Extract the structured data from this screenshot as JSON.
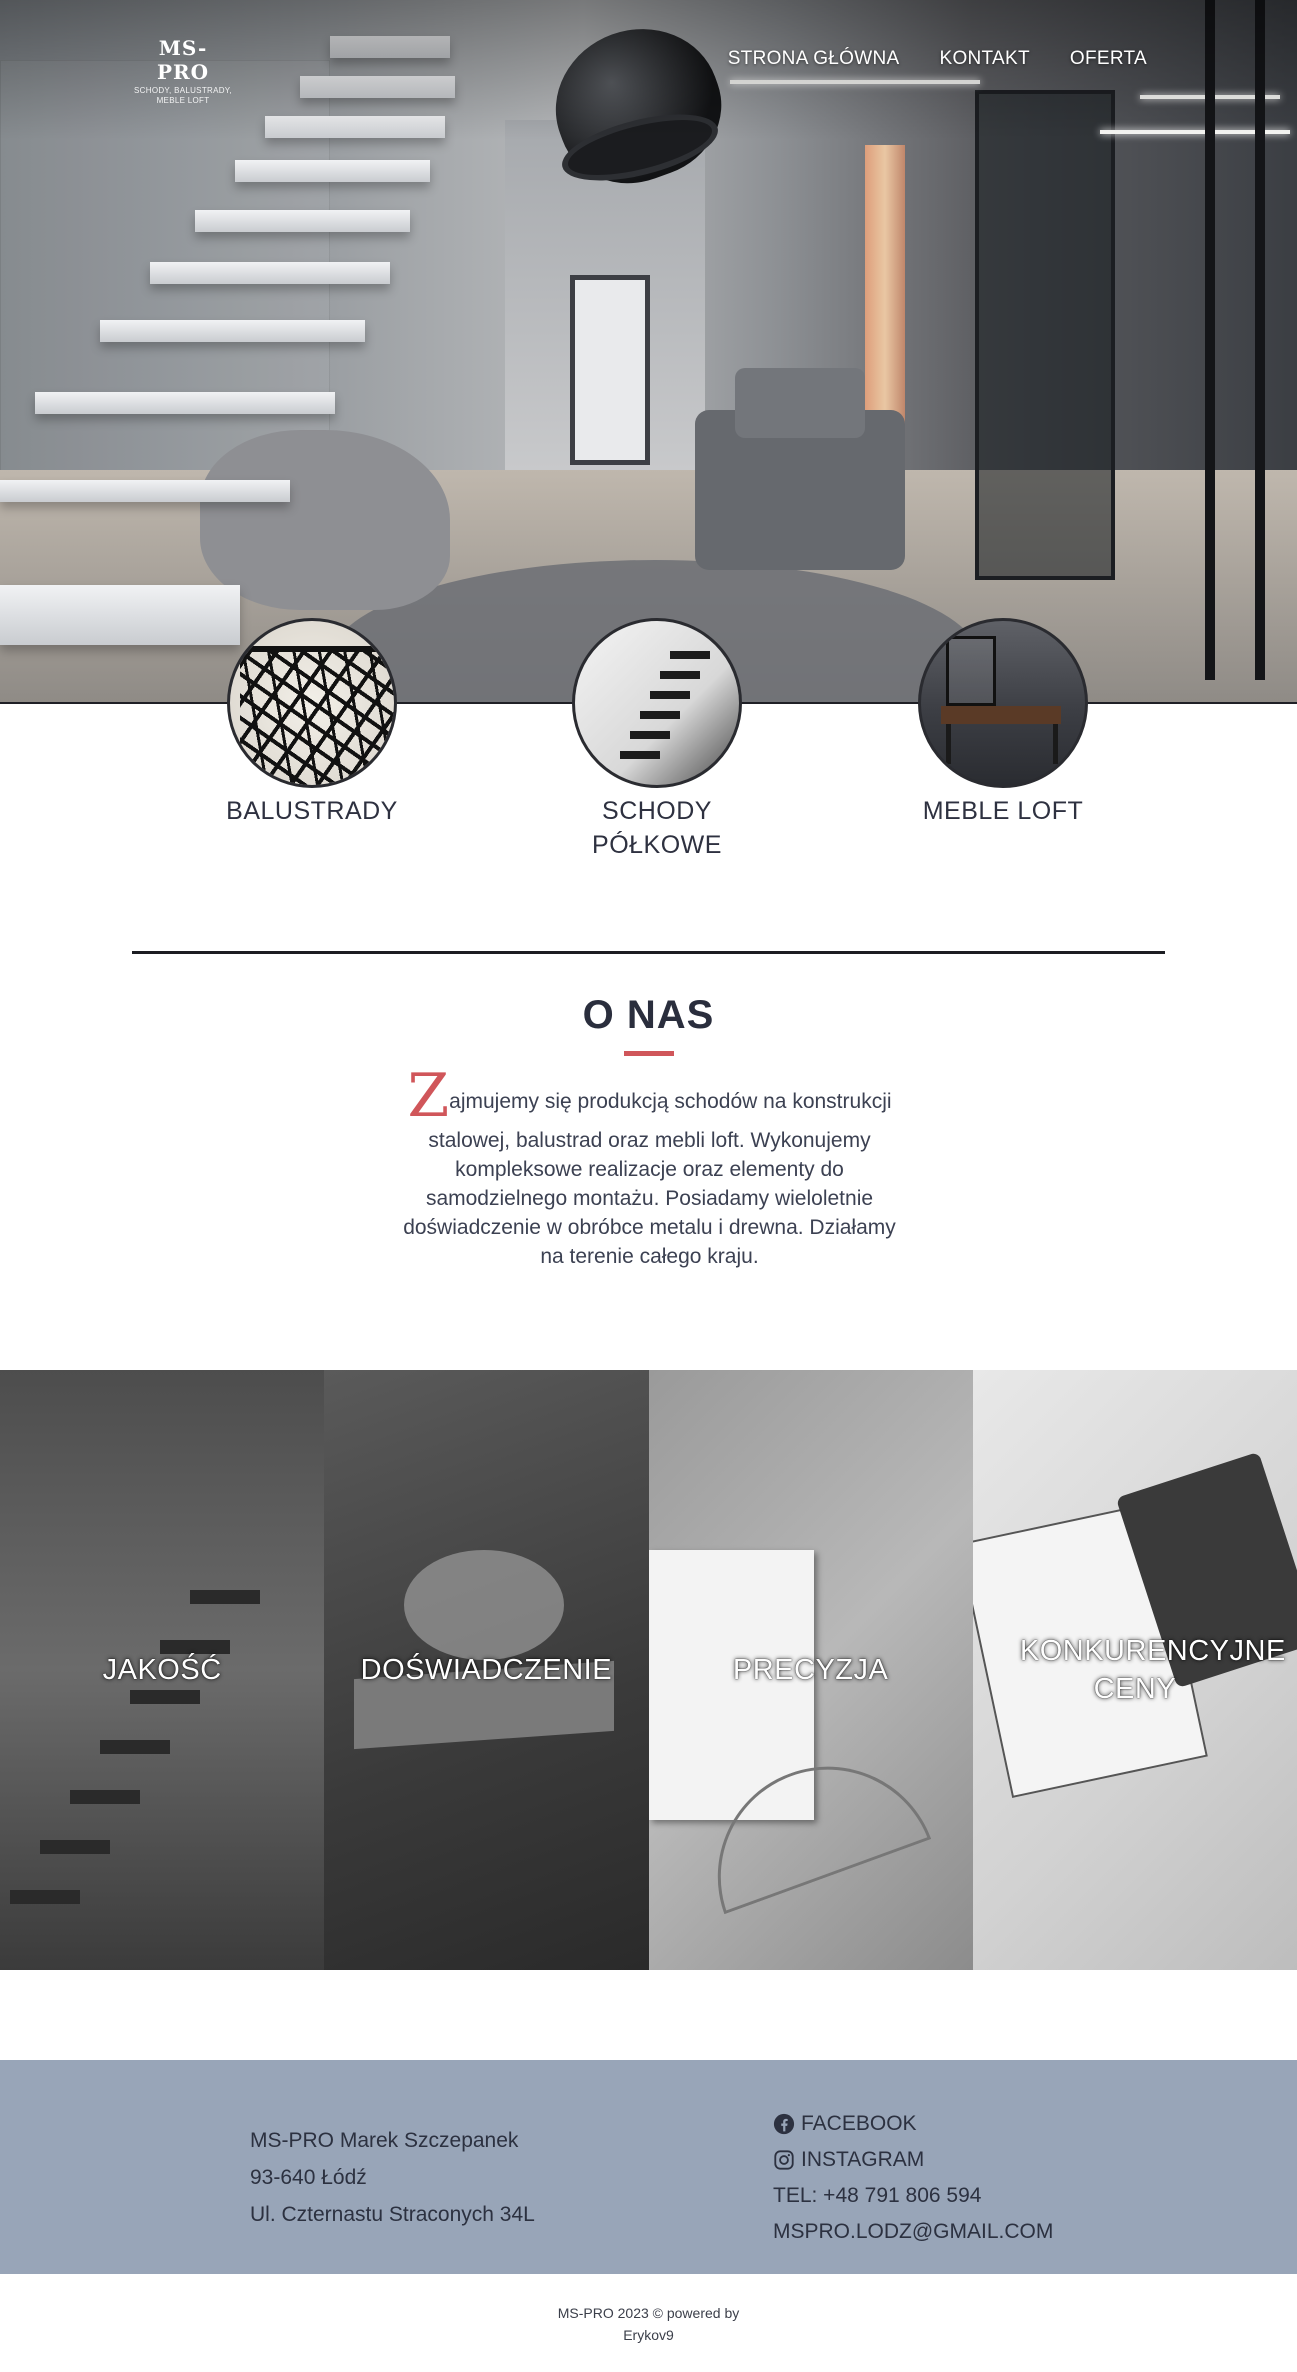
{
  "logo": {
    "title": "MS-PRO",
    "subtitle": "SCHODY, BALUSTRADY, MEBLE LOFT"
  },
  "nav": {
    "items": [
      {
        "label": "STRONA GŁÓWNA"
      },
      {
        "label": "KONTAKT"
      },
      {
        "label": "OFERTA"
      }
    ]
  },
  "categories": [
    {
      "label": "BALUSTRADY"
    },
    {
      "label": "SCHODY PÓŁKOWE"
    },
    {
      "label": "MEBLE LOFT"
    }
  ],
  "about": {
    "title": "O NAS",
    "drop_letter": "Z",
    "text": "ajmujemy się produkcją schodów na konstrukcji stalowej, balustrad oraz mebli loft. Wykonujemy kompleksowe realizacje oraz elementy do samodzielnego montażu. Posiadamy wieloletnie doświadczenie w obróbce metalu i drewna. Działamy na terenie całego kraju."
  },
  "features": [
    {
      "label": "JAKOŚĆ"
    },
    {
      "label": "DOŚWIADCZENIE"
    },
    {
      "label": "PRECYZJA"
    },
    {
      "label": "KONKURENCYJNE CENY"
    }
  ],
  "footer": {
    "address": {
      "name": "MS-PRO Marek Szczepanek",
      "city": "93-640 Łódź",
      "street": "Ul. Czternastu Straconych 34L"
    },
    "contact": {
      "facebook": "FACEBOOK",
      "instagram": "INSTAGRAM",
      "phone": "TEL: +48 791 806 594",
      "email": "MSPRO.LODZ@GMAIL.COM"
    },
    "copyright_line1": "MS-PRO 2023 © powered by",
    "copyright_line2": "Erykov9"
  },
  "colors": {
    "accent": "#d0565a",
    "footer_bg": "#98a5b8",
    "text_dark": "#2a2e3d"
  },
  "icons": [
    "facebook-icon",
    "instagram-icon"
  ]
}
